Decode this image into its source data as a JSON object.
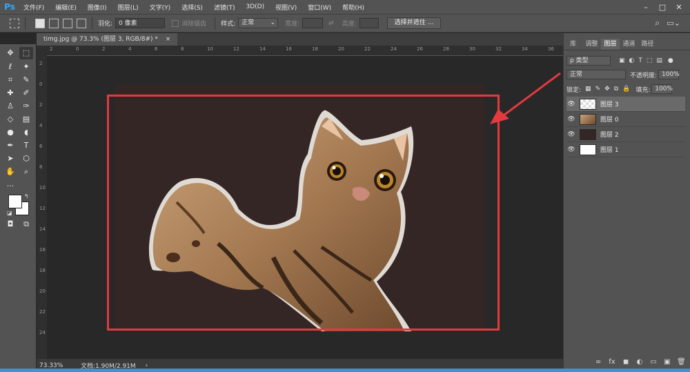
{
  "app": {
    "logo": "Ps",
    "menu": [
      "文件(F)",
      "编辑(E)",
      "图像(I)",
      "图层(L)",
      "文字(Y)",
      "选择(S)",
      "滤镜(T)",
      "3D(D)",
      "视图(V)",
      "窗口(W)",
      "帮助(H)"
    ],
    "window_controls": [
      "–",
      "□",
      "✕"
    ]
  },
  "options": {
    "feather_label": "羽化:",
    "feather_value": "0 像素",
    "antialias_label": "消除锯齿",
    "style_label": "样式:",
    "style_value": "正常",
    "width_label": "宽度:",
    "height_label": "高度:",
    "select_mask_button": "选择并遮住 ..."
  },
  "document": {
    "tab_title": "timg.jpg @ 73.3% (图层 3, RGB/8#) *",
    "tab_close": "×",
    "zoom": "73.33%",
    "doc_size": "文档:1.90M/2.91M",
    "status_arrow": "›"
  },
  "rulers": {
    "top": [
      "2",
      "0",
      "2",
      "4",
      "6",
      "8",
      "10",
      "12",
      "14",
      "16",
      "18",
      "20",
      "22",
      "24",
      "26",
      "28",
      "30",
      "32",
      "34",
      "36"
    ],
    "left": [
      "2",
      "0",
      "2",
      "4",
      "6",
      "8",
      "10",
      "12",
      "14",
      "16",
      "18",
      "20",
      "22",
      "24"
    ]
  },
  "panel": {
    "tabs": [
      "库",
      "调整",
      "图层",
      "通道",
      "路径"
    ],
    "active_tab": "图层",
    "filter_label": "ρ 类型",
    "blend_mode": "正常",
    "opacity_label": "不透明度:",
    "opacity_value": "100%",
    "lock_label": "锁定:",
    "fill_label": "填充:",
    "fill_value": "100%",
    "layers": [
      {
        "name": "图层 3",
        "active": true
      },
      {
        "name": "图层 0",
        "active": false
      },
      {
        "name": "图层 2",
        "active": false
      },
      {
        "name": "图层 1",
        "active": false
      }
    ],
    "bottom_icons": [
      "∞",
      "fx",
      "◼",
      "◐",
      "▭",
      "▣",
      "🗑"
    ]
  },
  "colors": {
    "canvas_bg": "#352626",
    "highlight": "#e23a3f",
    "ui_panel": "#535353",
    "accent": "#31a8ff"
  }
}
